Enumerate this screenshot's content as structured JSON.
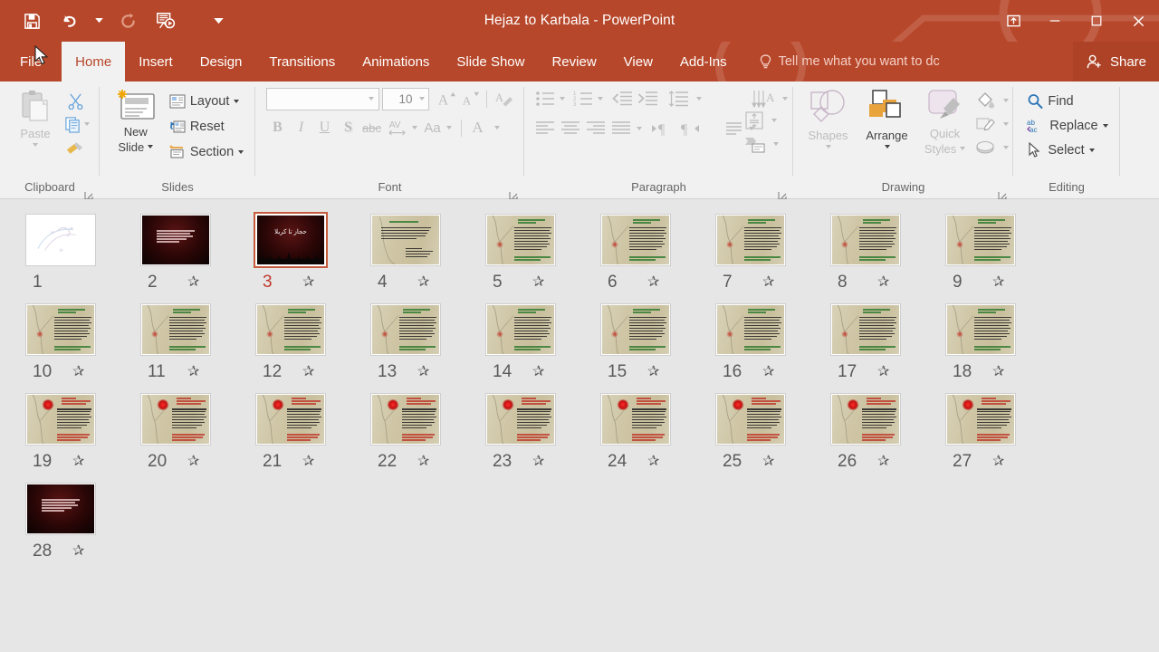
{
  "window": {
    "title": "Hejaz to Karbala - PowerPoint",
    "quick_access": [
      {
        "name": "save-icon",
        "label": "Save"
      },
      {
        "name": "undo-icon",
        "label": "Undo"
      },
      {
        "name": "redo-icon",
        "label": "Redo"
      },
      {
        "name": "start-from-beginning-icon",
        "label": "Start From Beginning"
      },
      {
        "name": "customize-quick-access-toolbar-icon",
        "label": "Customize Quick Access Toolbar"
      }
    ],
    "controls": [
      {
        "name": "ribbon-display-options-icon",
        "label": "Ribbon Display Options"
      },
      {
        "name": "minimize-icon",
        "label": "Minimize"
      },
      {
        "name": "restore-icon",
        "label": "Restore Down"
      },
      {
        "name": "close-icon",
        "label": "Close"
      }
    ]
  },
  "tabs": [
    {
      "label": "File",
      "active": false
    },
    {
      "label": "Home",
      "active": true
    },
    {
      "label": "Insert",
      "active": false
    },
    {
      "label": "Design",
      "active": false
    },
    {
      "label": "Transitions",
      "active": false
    },
    {
      "label": "Animations",
      "active": false
    },
    {
      "label": "Slide Show",
      "active": false
    },
    {
      "label": "Review",
      "active": false
    },
    {
      "label": "View",
      "active": false
    },
    {
      "label": "Add-Ins",
      "active": false
    }
  ],
  "tell_me": "Tell me what you want to dc",
  "share": "Share",
  "ribbon": {
    "groups": [
      {
        "label": "Clipboard"
      },
      {
        "label": "Slides"
      },
      {
        "label": "Font"
      },
      {
        "label": "Paragraph"
      },
      {
        "label": "Drawing"
      },
      {
        "label": "Editing"
      }
    ],
    "clipboard": {
      "paste": "Paste",
      "cut": "Cut",
      "copy": "Copy",
      "format_painter": "Format Painter"
    },
    "slides": {
      "new_slide": "New\nSlide",
      "new_slide_line1": "New",
      "new_slide_line2": "Slide",
      "layout": "Layout",
      "reset": "Reset",
      "section": "Section"
    },
    "font": {
      "font_name_value": "",
      "font_name_placeholder": "",
      "font_size_value": "10",
      "increase_font": "A",
      "decrease_font": "A",
      "clear_formatting": "Clear All Formatting",
      "bold": "B",
      "italic": "I",
      "underline": "U",
      "shadow": "S",
      "strikethrough": "abc",
      "character_spacing": "AV",
      "change_case": "Aa",
      "font_color": "A"
    },
    "paragraph": {
      "bullets": "Bullets",
      "numbering": "Numbering",
      "decrease_indent": "Decrease List Level",
      "increase_indent": "Increase List Level",
      "line_spacing": "Line Spacing",
      "align_left": "Align Left",
      "center": "Center",
      "align_right": "Align Right",
      "justify": "Justify",
      "columns": "Columns",
      "ltr": "Left-to-Right Text Direction",
      "rtl": "Right-to-Left Text Direction",
      "text_direction": "Text Direction",
      "align_text": "Align Text",
      "convert_smartart": "Convert to SmartArt"
    },
    "drawing": {
      "shapes": "Shapes",
      "arrange": "Arrange",
      "quick_styles_line1": "Quick",
      "quick_styles_line2": "Styles",
      "shape_fill": "Shape Fill",
      "shape_outline": "Shape Outline",
      "shape_effects": "Shape Effects"
    },
    "editing": {
      "find": "Find",
      "replace": "Replace",
      "select": "Select"
    }
  },
  "slides": [
    {
      "number": "1",
      "animated": false,
      "selected": false,
      "style": "white"
    },
    {
      "number": "2",
      "animated": true,
      "selected": false,
      "style": "dark-title"
    },
    {
      "number": "3",
      "animated": true,
      "selected": true,
      "style": "dark-banner",
      "title": "حجاز تا کربلا"
    },
    {
      "number": "4",
      "animated": true,
      "selected": false,
      "style": "parch-right"
    },
    {
      "number": "5",
      "animated": true,
      "selected": false,
      "style": "parch-green"
    },
    {
      "number": "6",
      "animated": true,
      "selected": false,
      "style": "parch-green"
    },
    {
      "number": "7",
      "animated": true,
      "selected": false,
      "style": "parch-green"
    },
    {
      "number": "8",
      "animated": true,
      "selected": false,
      "style": "parch-green"
    },
    {
      "number": "9",
      "animated": true,
      "selected": false,
      "style": "parch-green"
    },
    {
      "number": "10",
      "animated": true,
      "selected": false,
      "style": "parch-green"
    },
    {
      "number": "11",
      "animated": true,
      "selected": false,
      "style": "parch-green"
    },
    {
      "number": "12",
      "animated": true,
      "selected": false,
      "style": "parch-green"
    },
    {
      "number": "13",
      "animated": true,
      "selected": false,
      "style": "parch-green"
    },
    {
      "number": "14",
      "animated": true,
      "selected": false,
      "style": "parch-green"
    },
    {
      "number": "15",
      "animated": true,
      "selected": false,
      "style": "parch-green"
    },
    {
      "number": "16",
      "animated": true,
      "selected": false,
      "style": "parch-green"
    },
    {
      "number": "17",
      "animated": true,
      "selected": false,
      "style": "parch-green"
    },
    {
      "number": "18",
      "animated": true,
      "selected": false,
      "style": "parch-green"
    },
    {
      "number": "19",
      "animated": true,
      "selected": false,
      "style": "parch-red"
    },
    {
      "number": "20",
      "animated": true,
      "selected": false,
      "style": "parch-red"
    },
    {
      "number": "21",
      "animated": true,
      "selected": false,
      "style": "parch-red"
    },
    {
      "number": "22",
      "animated": true,
      "selected": false,
      "style": "parch-red"
    },
    {
      "number": "23",
      "animated": true,
      "selected": false,
      "style": "parch-red"
    },
    {
      "number": "24",
      "animated": true,
      "selected": false,
      "style": "parch-red"
    },
    {
      "number": "25",
      "animated": true,
      "selected": false,
      "style": "parch-red"
    },
    {
      "number": "26",
      "animated": true,
      "selected": false,
      "style": "parch-red"
    },
    {
      "number": "27",
      "animated": true,
      "selected": false,
      "style": "parch-red"
    },
    {
      "number": "28",
      "animated": true,
      "selected": false,
      "style": "dark-title"
    }
  ],
  "colors": {
    "accent": "#B7472A",
    "selection": "#C55A3C",
    "selected_number": "#C0392B",
    "ribbon_bg": "#F1F1F1",
    "workspace_bg": "#E6E6E6"
  }
}
